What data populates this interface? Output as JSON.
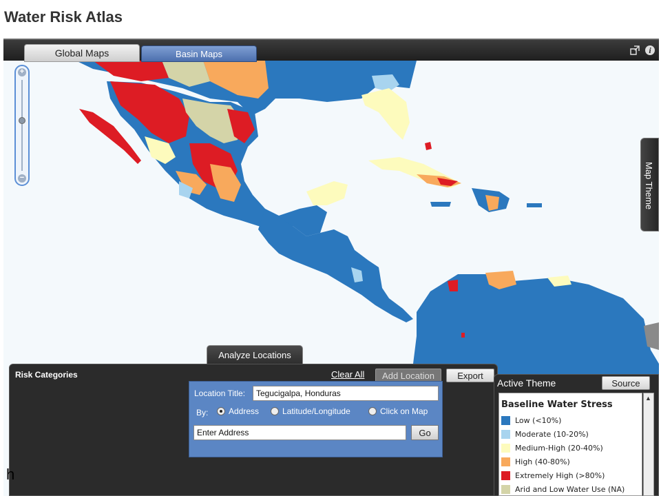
{
  "app_title": "Water Risk Atlas",
  "tabs": {
    "global": "Global Maps",
    "basin": "Basin Maps"
  },
  "top_icons": {
    "expand": "expand-icon",
    "info": "info-icon",
    "info_glyph": "i"
  },
  "zoom": {
    "in": "+",
    "out": "−",
    "level_fraction": 0.45
  },
  "map_theme_tab": "Map Theme",
  "analyze_tab": "Analyze Locations",
  "risk_panel": {
    "title": "Risk Categories",
    "clear_all": "Clear All",
    "add_location": "Add Location",
    "export": "Export"
  },
  "location_form": {
    "title_label": "Location Title:",
    "title_value": "Tegucigalpa, Honduras",
    "by_label": "By:",
    "options": [
      "Address",
      "Latitude/Longitude",
      "Click on Map"
    ],
    "selected": "Address",
    "address_placeholder": "Enter Address",
    "go": "Go"
  },
  "theme_panel": {
    "title": "Active Theme",
    "source": "Source",
    "legend_title": "Baseline Water Stress",
    "legend": [
      {
        "label": "Low (<10%)",
        "color": "#2b78be"
      },
      {
        "label": "Moderate (10-20%)",
        "color": "#a8d4ef"
      },
      {
        "label": "Medium-High (20-40%)",
        "color": "#fdfbbd"
      },
      {
        "label": "High (40-80%)",
        "color": "#f8a95c"
      },
      {
        "label": "Extremely High (>80%)",
        "color": "#dd1c24"
      },
      {
        "label": "Arid and Low Water Use (NA)",
        "color": "#d4d4a8"
      }
    ]
  },
  "colors": {
    "ocean": "#f4f9fc",
    "low": "#2b78be",
    "moderate": "#a8d4ef",
    "medium_high": "#fdfbbd",
    "high": "#f8a95c",
    "extremely_high": "#dd1c24",
    "arid": "#d4d4a8",
    "no_data": "#8a8a8a"
  },
  "stray_glyph": "h"
}
